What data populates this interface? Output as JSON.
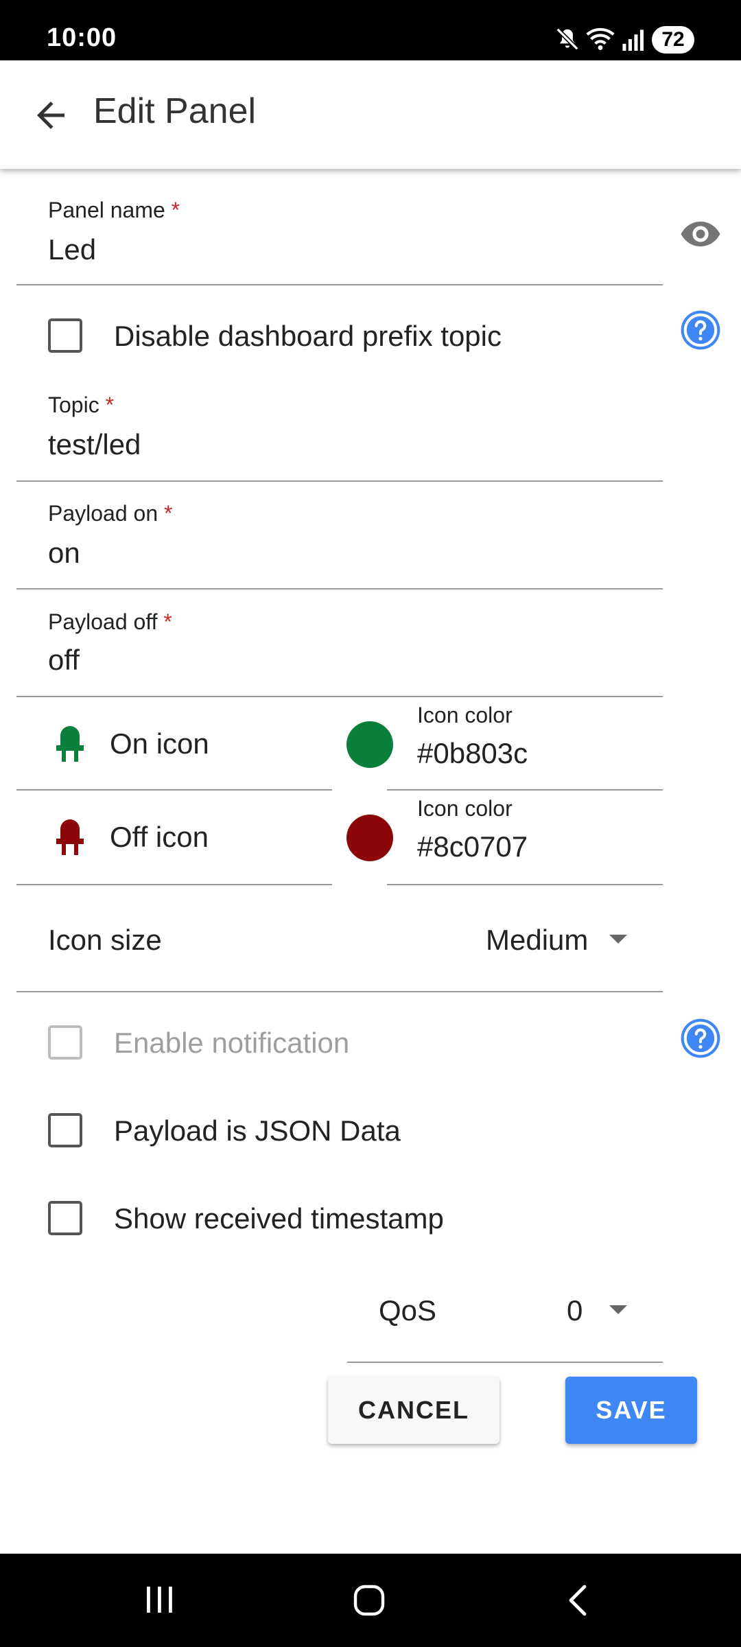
{
  "status_bar": {
    "time": "10:00",
    "battery": "72"
  },
  "app_bar": {
    "title": "Edit Panel"
  },
  "form": {
    "panel_name": {
      "label": "Panel name",
      "required_mark": "*",
      "value": "Led"
    },
    "disable_prefix": {
      "label": "Disable dashboard prefix topic",
      "checked": false
    },
    "topic": {
      "label": "Topic",
      "required_mark": "*",
      "value": "test/led"
    },
    "payload_on": {
      "label": "Payload on",
      "required_mark": "*",
      "value": "on"
    },
    "payload_off": {
      "label": "Payload off",
      "required_mark": "*",
      "value": "off"
    },
    "on_icon": {
      "label": "On icon",
      "color_label": "Icon color",
      "color_value": "#0b803c",
      "icon": "led-icon"
    },
    "off_icon": {
      "label": "Off icon",
      "color_label": "Icon color",
      "color_value": "#8c0707",
      "icon": "led-icon"
    },
    "icon_size": {
      "label": "Icon size",
      "value": "Medium"
    },
    "enable_notification": {
      "label": "Enable notification",
      "checked": false,
      "disabled": true
    },
    "payload_json": {
      "label": "Payload is JSON Data",
      "checked": false
    },
    "show_timestamp": {
      "label": "Show received timestamp",
      "checked": false
    },
    "qos": {
      "label": "QoS",
      "value": "0"
    }
  },
  "actions": {
    "cancel": "CANCEL",
    "save": "SAVE"
  },
  "colors": {
    "on": "#0b803c",
    "off": "#8c0707",
    "accent": "#3f87f5",
    "help": "#3f87f5"
  }
}
